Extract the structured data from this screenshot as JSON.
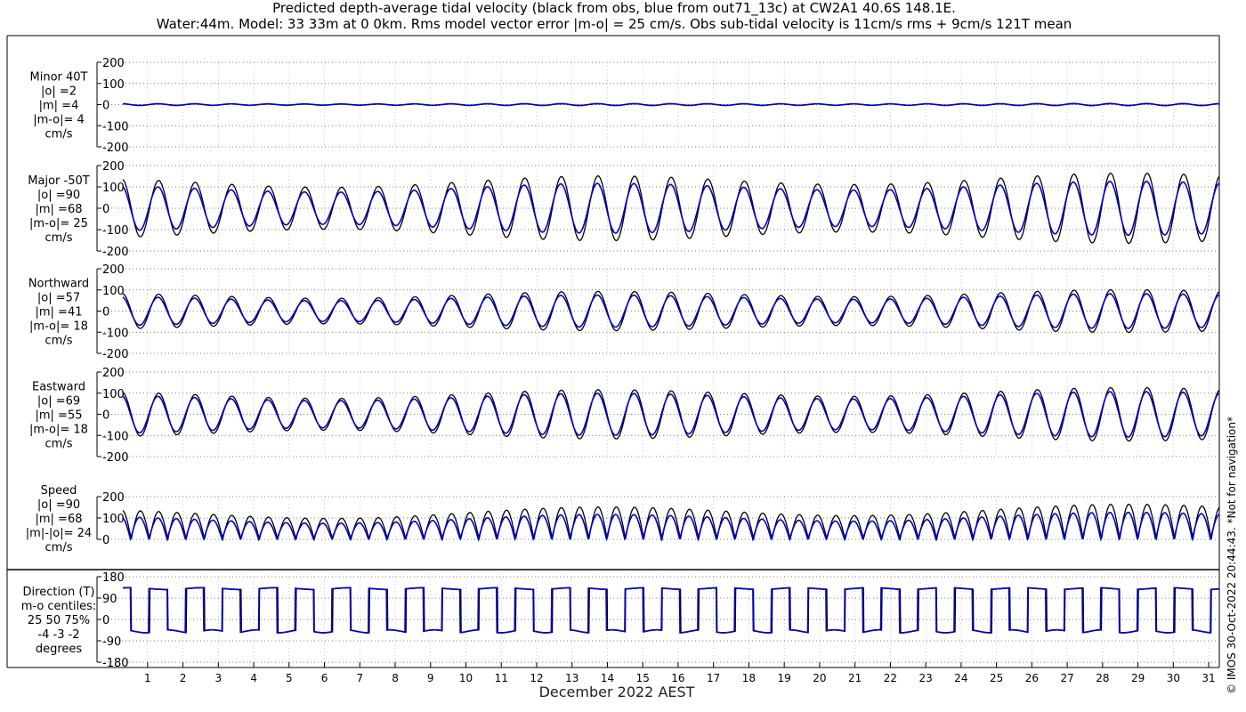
{
  "title": {
    "line1": "Predicted depth-average tidal velocity (black from obs, blue from out71_13c) at CW2A1 40.6S 148.1E.",
    "line2": "Water:44m. Model: 33 33m at 0 0km. Rms model vector error |m-o| = 25 cm/s. Obs sub-tidal velocity is 11cm/s rms + 9cm/s 121T mean"
  },
  "footer": {
    "xlabel": "December 2022 AEST",
    "copyright": "© IMOS 30-Oct-2022 20:44:43. *Not for navigation*"
  },
  "colors": {
    "obs": "#000000",
    "model": "#0000cc",
    "grid": "#555555"
  },
  "chart_data": {
    "type": "line",
    "x_unit": "day of December 2022",
    "xlim": [
      0.3,
      31.3
    ],
    "x_ticks": [
      1,
      2,
      3,
      4,
      5,
      6,
      7,
      8,
      9,
      10,
      11,
      12,
      13,
      14,
      15,
      16,
      17,
      18,
      19,
      20,
      21,
      22,
      23,
      24,
      25,
      26,
      27,
      28,
      29,
      30,
      31
    ],
    "x_tick_labels": [
      "1",
      "2",
      "3",
      "4",
      "5",
      "6",
      "7",
      "8",
      "9",
      "10",
      "11",
      "12",
      "13",
      "14",
      "15",
      "16",
      "17",
      "18",
      "19",
      "20",
      "21",
      "22",
      "23",
      "24",
      "25",
      "26",
      "27",
      "28",
      "29",
      "30",
      "31"
    ],
    "grid": true,
    "series_notes": [
      "obs",
      "model"
    ],
    "panels": [
      {
        "id": "minor",
        "label_lines": [
          "Minor 40T",
          "|o| =2",
          "|m| =4",
          "|m-o|= 4",
          "cm/s"
        ],
        "ylim": [
          -200,
          200
        ],
        "y_ticks": [
          200,
          100,
          0,
          -100,
          -200
        ],
        "y_tick_labels": [
          "200",
          "100",
          "0",
          "-100",
          "-200"
        ],
        "obs_amplitude": 3,
        "model_amplitude": 4
      },
      {
        "id": "major",
        "label_lines": [
          "Major -50T",
          "|o| =90",
          "|m| =68",
          "|m-o|= 25",
          "cm/s"
        ],
        "ylim": [
          -200,
          200
        ],
        "y_ticks": [
          200,
          100,
          0,
          -100,
          -200
        ],
        "y_tick_labels": [
          "200",
          "100",
          "0",
          "-100",
          "-200"
        ],
        "obs_amplitude": 130,
        "model_amplitude": 100
      },
      {
        "id": "northward",
        "label_lines": [
          "Northward",
          "|o| =57",
          "|m| =41",
          "|m-o|= 18",
          "cm/s"
        ],
        "ylim": [
          -200,
          200
        ],
        "y_ticks": [
          200,
          100,
          0,
          -100,
          -200
        ],
        "y_tick_labels": [
          "200",
          "100",
          "0",
          "-100",
          "-200"
        ],
        "obs_amplitude": 80,
        "model_amplitude": 65
      },
      {
        "id": "eastward",
        "label_lines": [
          "Eastward",
          "|o| =69",
          "|m| =55",
          "|m-o|= 18",
          "cm/s"
        ],
        "ylim": [
          -200,
          200
        ],
        "y_ticks": [
          200,
          100,
          0,
          -100,
          -200
        ],
        "y_tick_labels": [
          "200",
          "100",
          "0",
          "-100",
          "-200"
        ],
        "obs_amplitude": 100,
        "model_amplitude": 85
      },
      {
        "id": "speed",
        "label_lines": [
          "Speed",
          "|o| =90",
          "|m| =68",
          "|m|-|o|= 24",
          "cm/s"
        ],
        "ylim": [
          0,
          200
        ],
        "y_ticks": [
          200,
          100,
          0
        ],
        "y_tick_labels": [
          "200",
          "100",
          "0"
        ],
        "obs_amplitude": 130,
        "model_amplitude": 100
      },
      {
        "id": "direction",
        "label_lines": [
          "Direction (T)",
          "m-o centiles:",
          "25  50  75%",
          "-4 -3 -2",
          "degrees"
        ],
        "ylim": [
          -180,
          180
        ],
        "y_ticks": [
          180,
          90,
          0,
          -90,
          -180
        ],
        "y_tick_labels": [
          "180",
          "90",
          "0",
          "-90",
          "-180"
        ],
        "flood_direction": 130,
        "ebb_direction": -50
      }
    ]
  }
}
